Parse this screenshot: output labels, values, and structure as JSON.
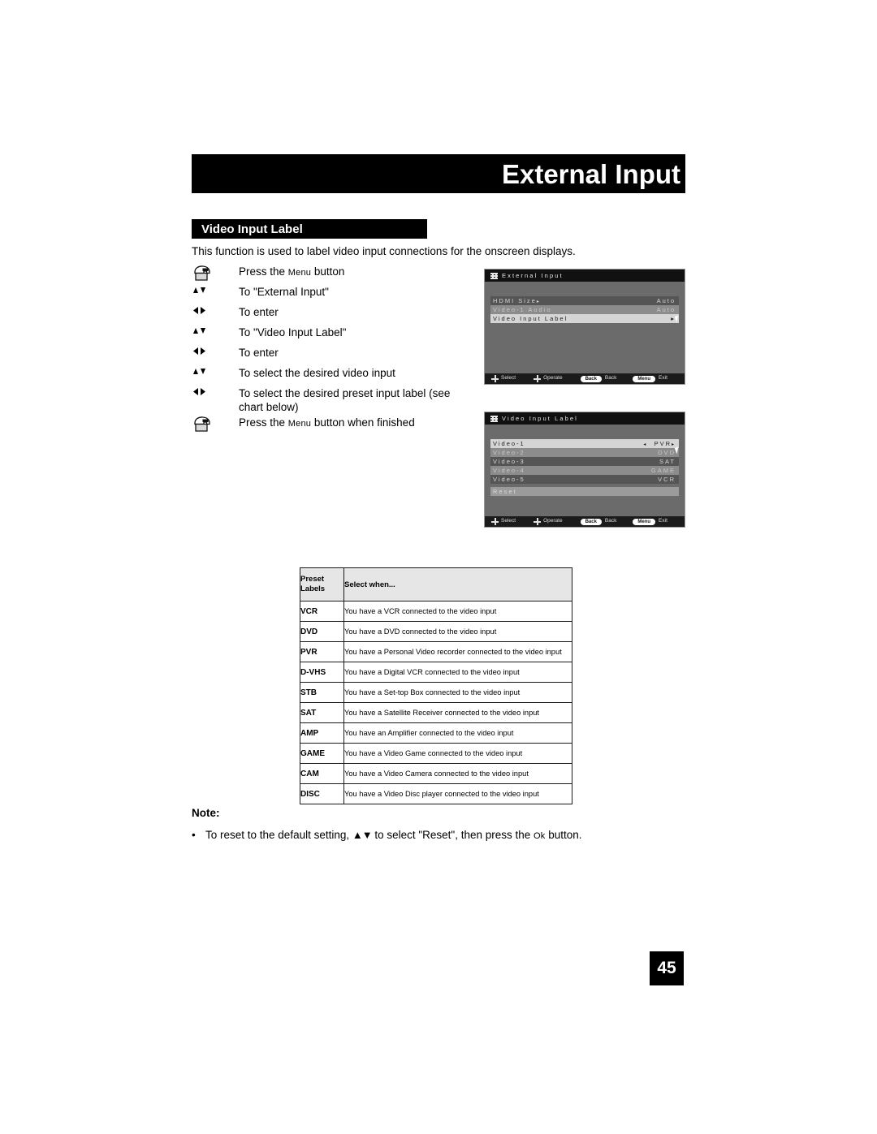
{
  "header": {
    "title": "External Input"
  },
  "section": {
    "title": "Video Input Label"
  },
  "intro": "This function is used to label video input connections for the onscreen displays.",
  "steps": [
    {
      "icon": "hand-press-icon",
      "icon_kind": "hand",
      "text_pre": "Press the ",
      "text_caps": "Menu",
      "text_post": " button"
    },
    {
      "icon": "up-down-arrows-icon",
      "icon_kind": "ud",
      "text_pre": "To \"External Input\"",
      "text_caps": "",
      "text_post": ""
    },
    {
      "icon": "left-right-arrows-icon",
      "icon_kind": "lr",
      "text_pre": "To enter",
      "text_caps": "",
      "text_post": ""
    },
    {
      "icon": "up-down-arrows-icon",
      "icon_kind": "ud",
      "text_pre": "To \"Video Input Label\"",
      "text_caps": "",
      "text_post": ""
    },
    {
      "icon": "left-right-arrows-icon",
      "icon_kind": "lr",
      "text_pre": "To enter",
      "text_caps": "",
      "text_post": ""
    },
    {
      "icon": "up-down-arrows-icon",
      "icon_kind": "ud",
      "text_pre": "To select the desired video input",
      "text_caps": "",
      "text_post": ""
    },
    {
      "icon": "left-right-arrows-icon",
      "icon_kind": "lr",
      "text_pre": "To select the desired preset input label (see chart below)",
      "text_caps": "",
      "text_post": ""
    },
    {
      "icon": "hand-press-icon",
      "icon_kind": "hand",
      "text_pre": "Press the ",
      "text_caps": "Menu",
      "text_post": " button when finished"
    }
  ],
  "osd_external_input": {
    "title": "External Input",
    "rows": [
      {
        "label": "HDMI Size",
        "arrow": "▸",
        "value": "Auto",
        "shade": "sh-dark"
      },
      {
        "label": "Video-1 Audio",
        "arrow": "",
        "value": "Auto",
        "shade": "sh-mid"
      },
      {
        "label": "Video Input Label",
        "arrow": "",
        "value": "▸",
        "shade": "sh-light"
      }
    ],
    "footer": {
      "select": "Select",
      "operate": "Operate",
      "back_pill": "Back",
      "back_label": "Back",
      "menu_pill": "Menu",
      "exit_label": "Exit"
    }
  },
  "osd_video_input_label": {
    "title": "Video Input Label",
    "rows": [
      {
        "label": "Video-1",
        "left_arrow": "◂",
        "value": "PVR",
        "right_arrow": "▸",
        "shade": "sh-light"
      },
      {
        "label": "Video-2",
        "left_arrow": "",
        "value": "DVD",
        "right_arrow": "",
        "shade": "sh-mid"
      },
      {
        "label": "Video-3",
        "left_arrow": "",
        "value": "SAT",
        "right_arrow": "",
        "shade": "sh-dark"
      },
      {
        "label": "Video-4",
        "left_arrow": "",
        "value": "GAME",
        "right_arrow": "",
        "shade": "sh-mid"
      },
      {
        "label": "Video-5",
        "left_arrow": "",
        "value": "VCR",
        "right_arrow": "",
        "shade": "sh-dark"
      }
    ],
    "reset_row": {
      "label": "Reset",
      "shade": "sh-mid2"
    },
    "footer": {
      "select": "Select",
      "operate": "Operate",
      "back_pill": "Back",
      "back_label": "Back",
      "menu_pill": "Menu",
      "exit_label": "Exit"
    }
  },
  "preset_table": {
    "headers": {
      "col1_line1": "Preset",
      "col1_line2": "Labels",
      "col2": "Select when..."
    },
    "rows": [
      {
        "label": "VCR",
        "desc": "You have a VCR connected to the video input"
      },
      {
        "label": "DVD",
        "desc": "You have a DVD connected to the video input"
      },
      {
        "label": "PVR",
        "desc": "You have a Personal Video recorder connected to the video input"
      },
      {
        "label": "D-VHS",
        "desc": "You have a Digital VCR connected to the video input"
      },
      {
        "label": "STB",
        "desc": "You have a Set-top Box connected to the video input"
      },
      {
        "label": "SAT",
        "desc": "You have a Satellite Receiver connected to the video input"
      },
      {
        "label": "AMP",
        "desc": "You have an Amplifier connected to the video input"
      },
      {
        "label": "GAME",
        "desc": "You have a Video Game connected to the video input"
      },
      {
        "label": "CAM",
        "desc": "You have a Video Camera connected to the video input"
      },
      {
        "label": "DISC",
        "desc": "You have a Video Disc player connected to the video input"
      }
    ]
  },
  "note": {
    "title": "Note:",
    "bullet": "•",
    "text_pre": "To reset to the default setting, ",
    "arrows": "▲▼",
    "text_mid": " to select \"Reset\", then press the ",
    "ok_caps": "Ok",
    "text_post": " button."
  },
  "page_number": "45"
}
